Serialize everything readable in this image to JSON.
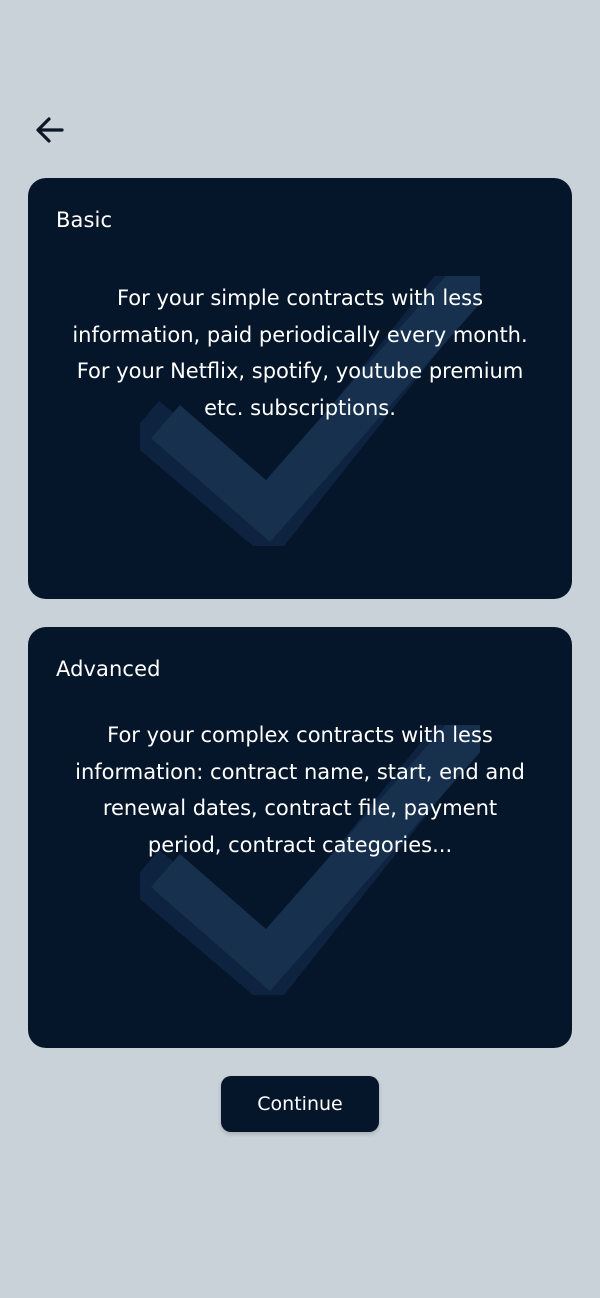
{
  "header": {
    "back_icon": "arrow-left-icon"
  },
  "cards": [
    {
      "title": "Basic",
      "description": "For your simple contracts with less information, paid periodically every month. For your Netflix, spotify, youtube premium etc. subscriptions.",
      "background_icon": "checkmark-icon"
    },
    {
      "title": "Advanced",
      "description": "For your complex contracts with less information: contract name, start, end and renewal dates, contract file, payment period, contract categories...",
      "background_icon": "checkmark-icon"
    }
  ],
  "actions": {
    "continue_label": "Continue"
  },
  "colors": {
    "page_background": "#c9d1d9",
    "card_background": "#05152a",
    "checkmark": "#16304e",
    "text": "#ffffff"
  }
}
